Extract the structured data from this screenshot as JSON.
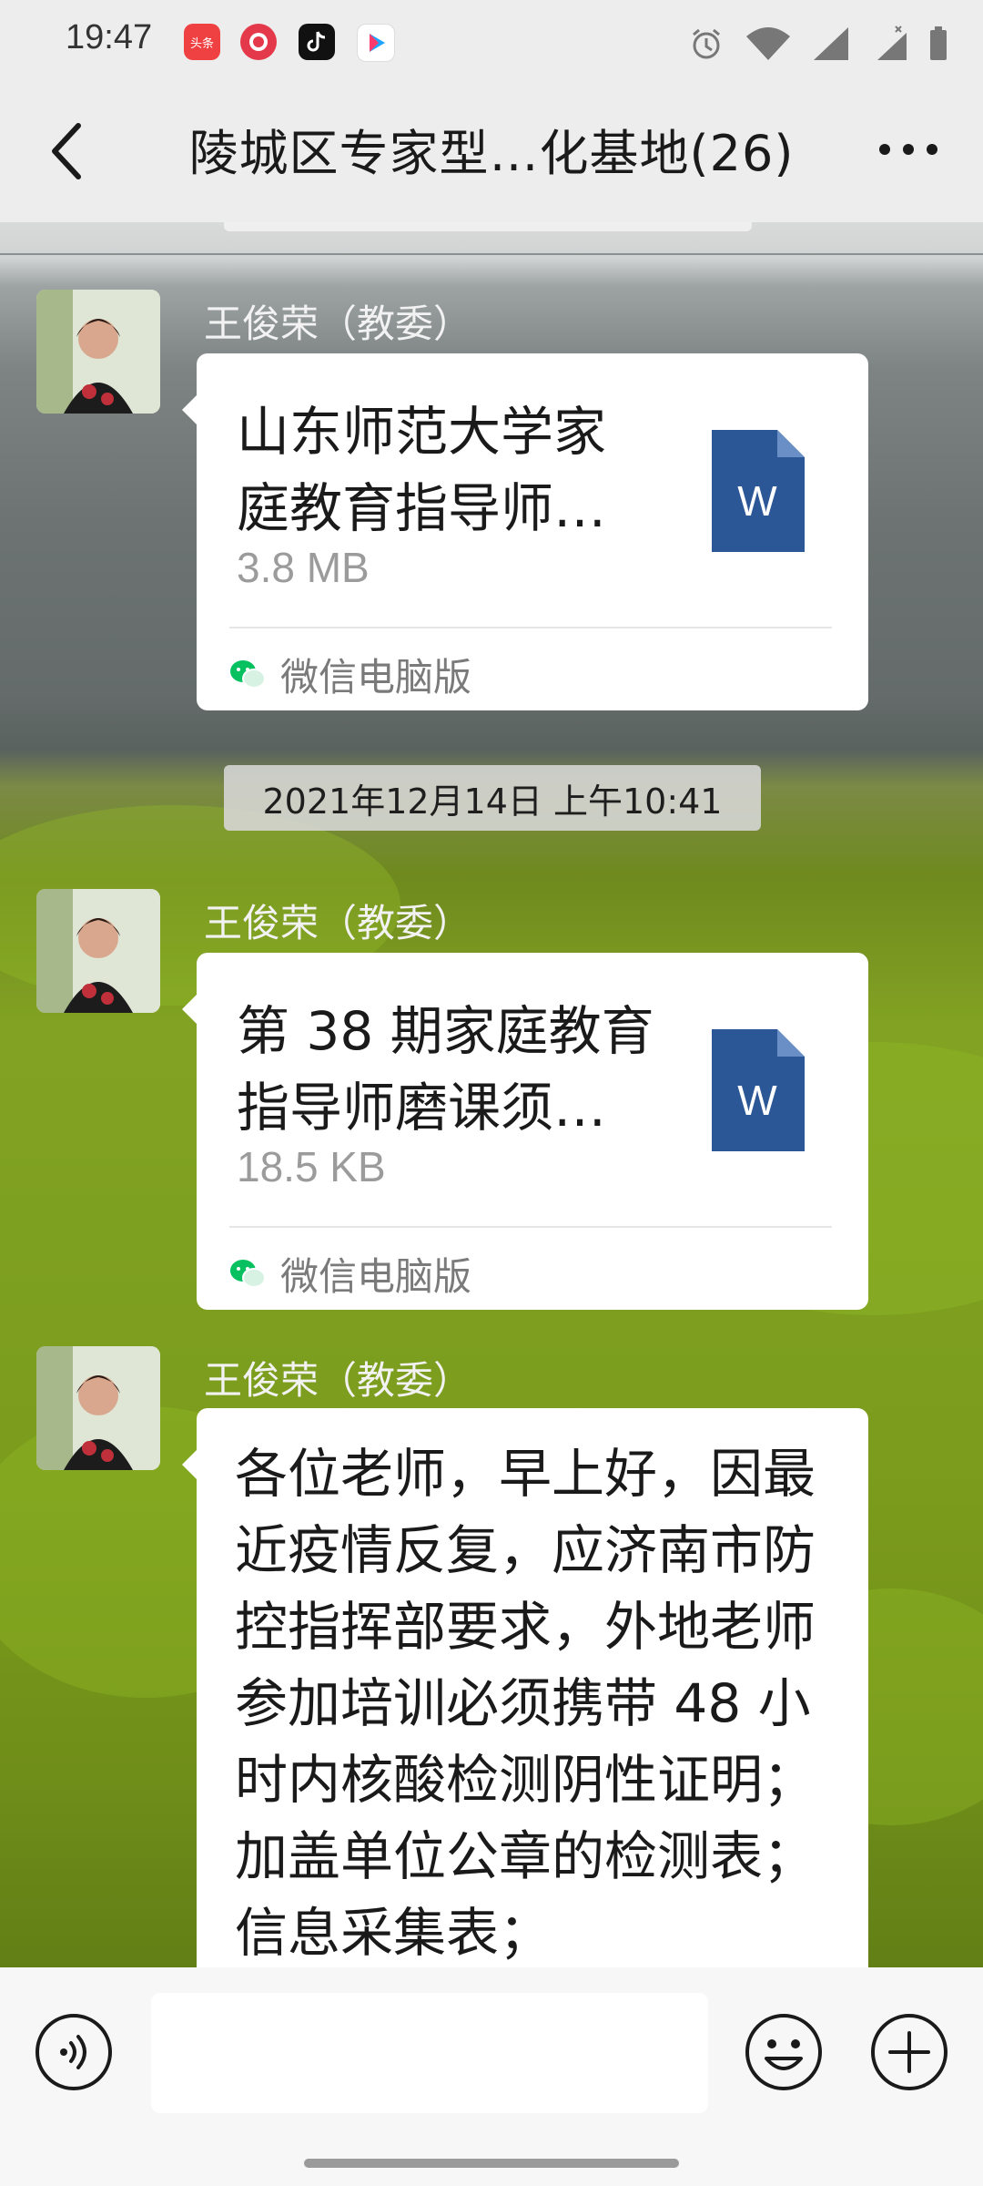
{
  "status_bar": {
    "time": "19:47",
    "apps": [
      {
        "icon": "toutiao-icon",
        "label": "头条",
        "color": "#f04142"
      },
      {
        "icon": "weibo-like-icon",
        "label": "",
        "color": "#e4394a"
      },
      {
        "icon": "tiktok-icon",
        "label": "",
        "color": "#111111"
      },
      {
        "icon": "youku-icon",
        "label": "YOUKU",
        "color": "#ffffff"
      }
    ],
    "system_icons": [
      "alarm-icon",
      "wifi-icon",
      "signal-icon",
      "signal-x-icon",
      "battery-icon"
    ]
  },
  "header": {
    "title": "陵城区专家型…化基地(26)",
    "back_icon": "chevron-left-icon",
    "more_icon": "more-dots-icon"
  },
  "messages": [
    {
      "type": "file",
      "sender": "王俊荣（教委）",
      "file_name": "山东师范大学家庭教育指导师…",
      "file_size": "3.8 MB",
      "file_icon": "word-doc-icon",
      "file_icon_letter": "W",
      "source": "微信电脑版"
    },
    {
      "type": "timestamp",
      "text": "2021年12月14日 上午10:41"
    },
    {
      "type": "file",
      "sender": "王俊荣（教委）",
      "file_name": "第 38 期家庭教育指导师磨课须…",
      "file_size": "18.5 KB",
      "file_icon": "word-doc-icon",
      "file_icon_letter": "W",
      "source": "微信电脑版"
    },
    {
      "type": "text",
      "sender": "王俊荣（教委）",
      "text": "各位老师，早上好，因最近疫情反复，应济南市防控指挥部要求，外地老师参加培训必须携带 48 小时内核酸检测阴性证明；加盖单位公章的检测表；信息采集表；"
    }
  ],
  "input_bar": {
    "voice_icon": "voice-icon",
    "emoji_icon": "emoji-icon",
    "plus_icon": "plus-icon",
    "input_value": ""
  },
  "colors": {
    "word_blue": "#2b5797",
    "bubble_bg": "#ffffff",
    "wechat_green": "#07c160"
  }
}
